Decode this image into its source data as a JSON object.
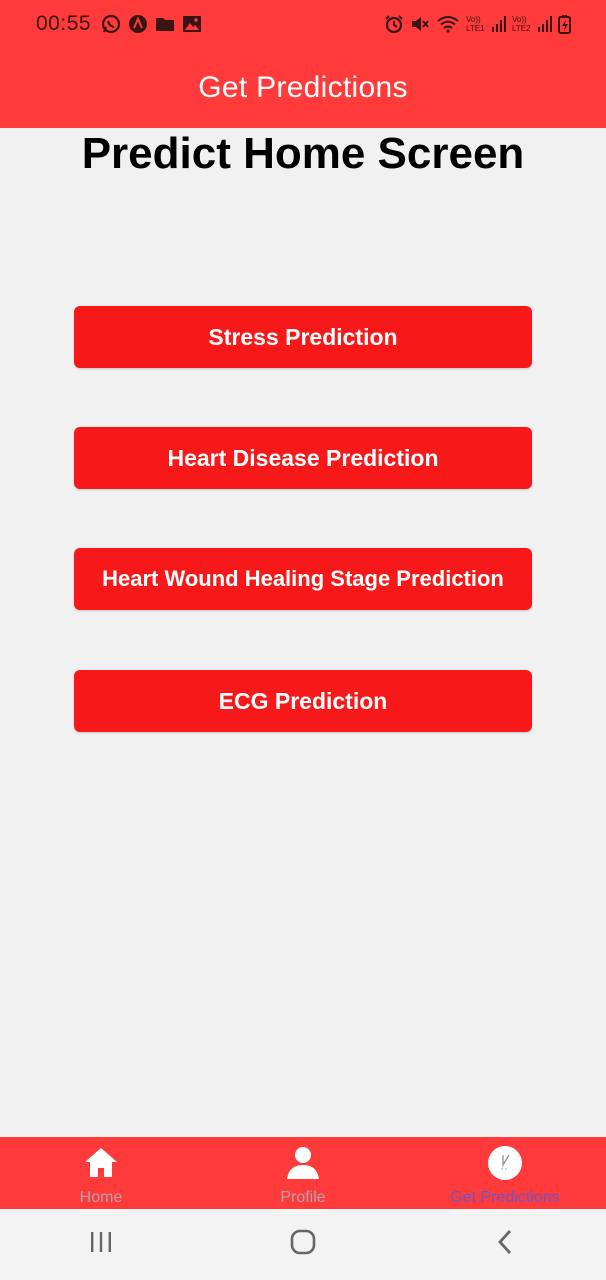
{
  "status_bar": {
    "time": "00:55",
    "left_icons": [
      "whatsapp-icon",
      "app-icon",
      "folder-icon",
      "gallery-icon"
    ],
    "right_icons": [
      "alarm-icon",
      "mute-icon",
      "wifi-icon",
      "lte1-signal-icon",
      "lte2-signal-icon",
      "battery-charging-icon"
    ]
  },
  "app_bar": {
    "title": "Get Predictions"
  },
  "main": {
    "heading": "Predict Home Screen",
    "buttons": [
      {
        "label": "Stress Prediction"
      },
      {
        "label": "Heart Disease Prediction"
      },
      {
        "label": "Heart Wound Healing Stage Prediction"
      },
      {
        "label": "ECG Prediction"
      }
    ],
    "button_color": "#f71919"
  },
  "bottom_nav": {
    "items": [
      {
        "label": "Home",
        "icon": "home-icon"
      },
      {
        "label": "Profile",
        "icon": "profile-icon"
      },
      {
        "label": "Get Predictions",
        "icon": "predictions-icon",
        "active": true
      }
    ],
    "active_color": "#6a55c8",
    "inactive_color": "#b8a0b0"
  },
  "colors": {
    "primary": "#ff3a3a",
    "background": "#f1f1f1"
  },
  "system_nav": {
    "icons": [
      "recent-apps-icon",
      "home-circle-icon",
      "back-icon"
    ]
  }
}
